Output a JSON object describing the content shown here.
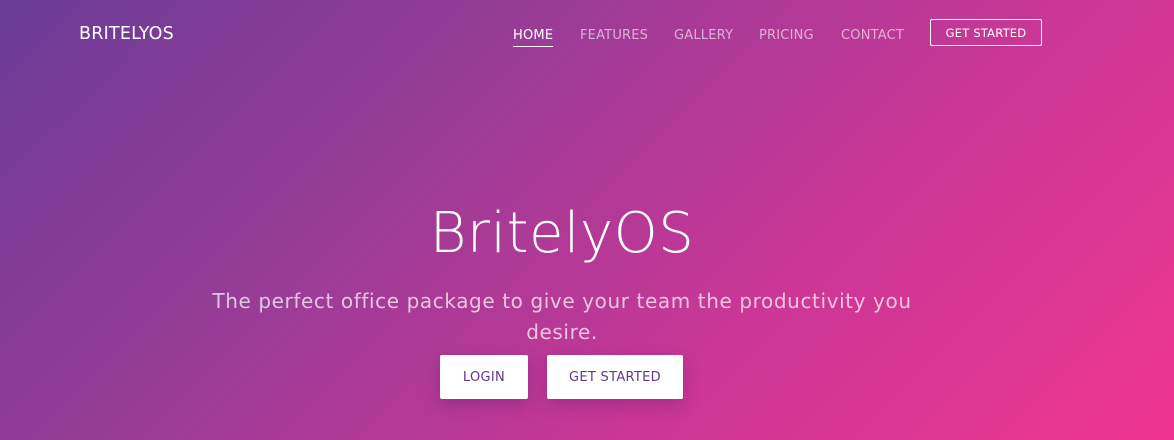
{
  "header": {
    "brand": "BRITELYOS",
    "nav": [
      {
        "label": "HOME",
        "active": true
      },
      {
        "label": "FEATURES",
        "active": false
      },
      {
        "label": "GALLERY",
        "active": false
      },
      {
        "label": "PRICING",
        "active": false
      },
      {
        "label": "CONTACT",
        "active": false
      }
    ],
    "cta_label": "GET STARTED"
  },
  "hero": {
    "title": "BritelyOS",
    "subtitle": "The perfect office package to give your team the productivity you desire.",
    "login_label": "LOGIN",
    "get_started_label": "GET STARTED"
  },
  "colors": {
    "gradient_start": "#6a3c97",
    "gradient_end": "#ef3591",
    "button_text": "#5e3a8c"
  }
}
